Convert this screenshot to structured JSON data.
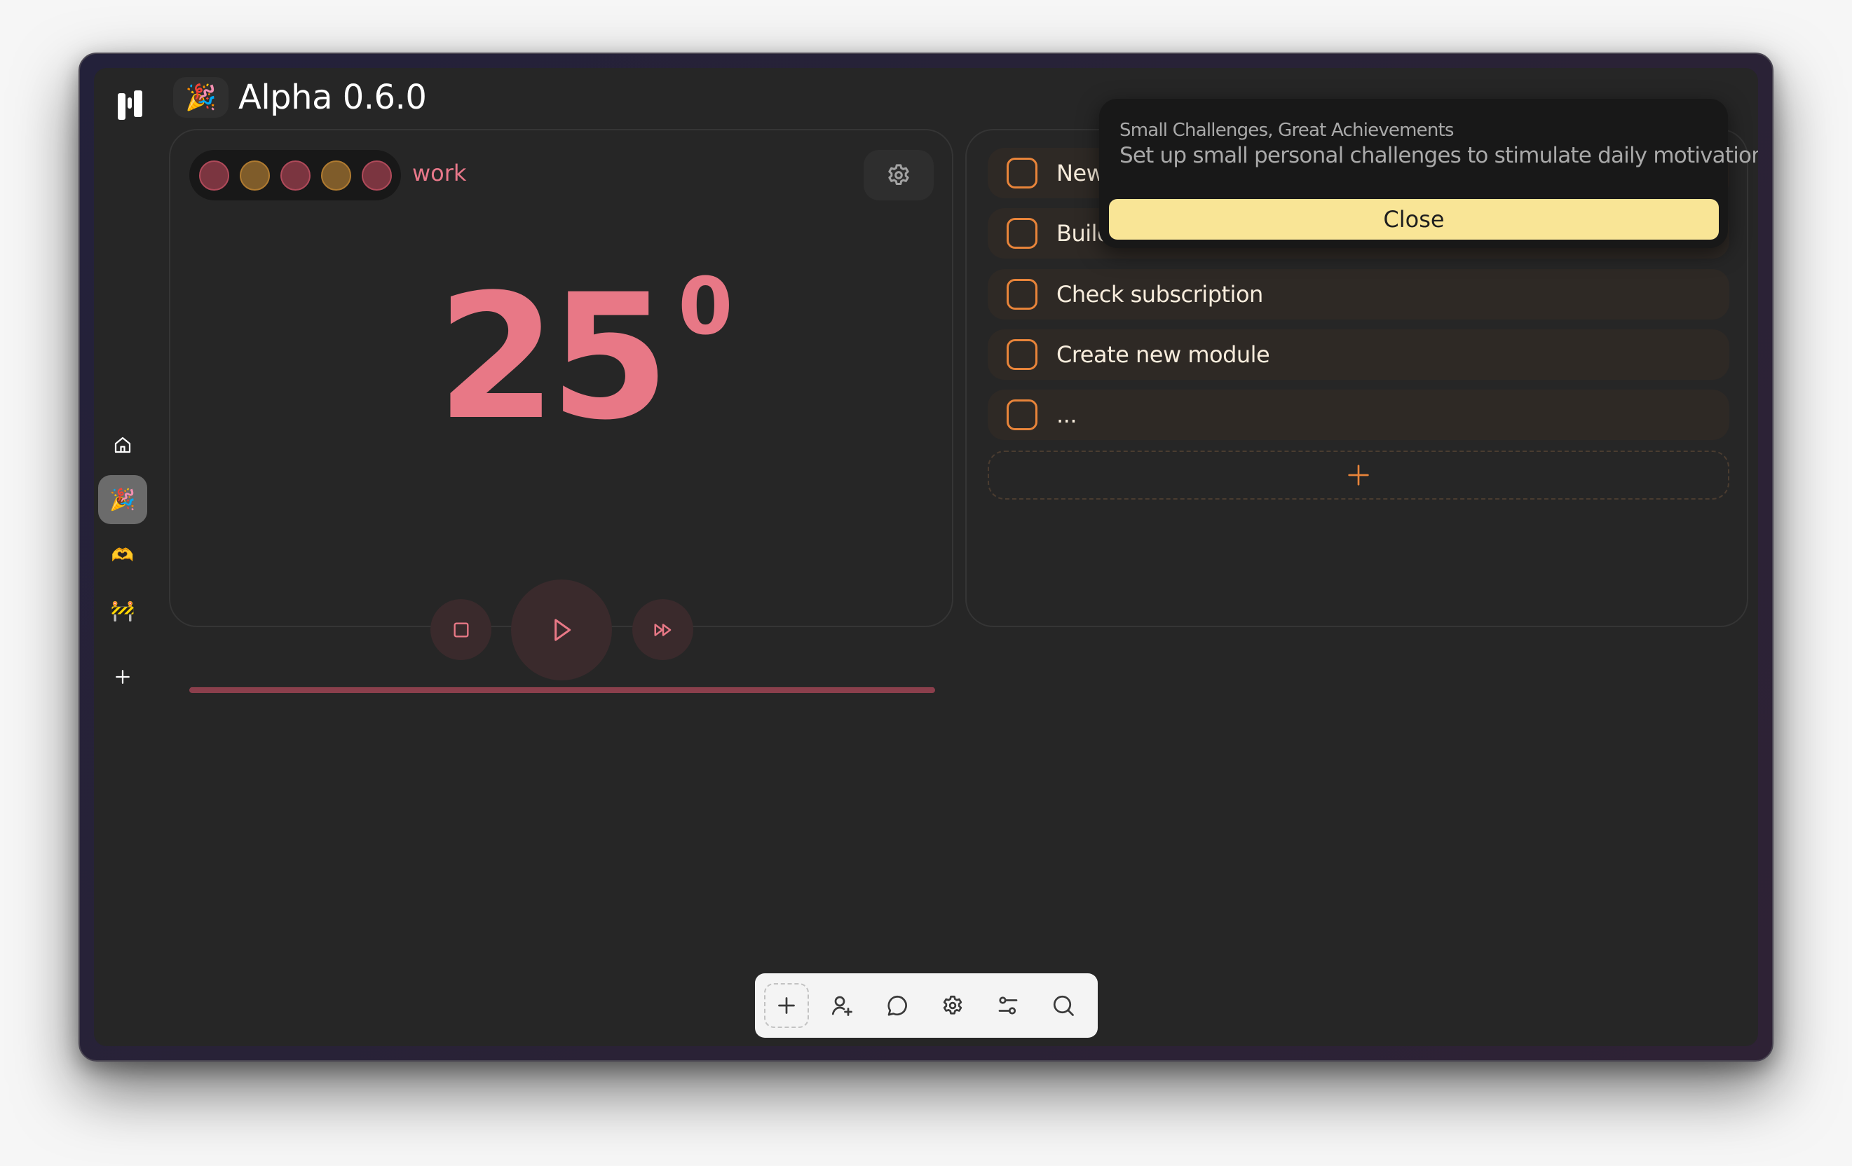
{
  "app": {
    "title": "Alpha 0.6.0",
    "title_emoji": "🎉",
    "logo_icon": "bars-logo-icon"
  },
  "sidebar": {
    "items": [
      {
        "name": "home",
        "icon": "home-icon",
        "glyph": "",
        "active": false
      },
      {
        "name": "party",
        "icon": "party-popper-icon",
        "glyph": "🎉",
        "active": true
      },
      {
        "name": "heart-hands",
        "icon": "heart-hands-icon",
        "glyph": "🫶",
        "active": false
      },
      {
        "name": "construction",
        "icon": "construction-icon",
        "glyph": "🚧",
        "active": false
      },
      {
        "name": "add",
        "icon": "plus-icon",
        "glyph": "",
        "active": false
      }
    ]
  },
  "timer": {
    "mode_label": "work",
    "sessions": [
      {
        "kind": "work",
        "color": "#7b3540"
      },
      {
        "kind": "break",
        "color": "#7f5c2a"
      },
      {
        "kind": "work",
        "color": "#7b3540"
      },
      {
        "kind": "break",
        "color": "#7f5c2a"
      },
      {
        "kind": "work",
        "color": "#7b3540"
      }
    ],
    "minutes": "25",
    "seconds_sup": "0",
    "progress": 1.0,
    "accent_color": "#e87886",
    "controls": [
      "stop",
      "play",
      "skip"
    ]
  },
  "tasks": {
    "items": [
      {
        "label": "New",
        "checked": false
      },
      {
        "label": "Build",
        "checked": false
      },
      {
        "label": "Check subscription",
        "checked": false
      },
      {
        "label": "Create new module",
        "checked": false
      },
      {
        "label": "...",
        "checked": false
      }
    ],
    "add_label": "+",
    "accent_color": "#e8843a"
  },
  "popover": {
    "title": "Small Challenges, Great Achievements",
    "body": "Set up small personal challenges to stimulate daily motivation.",
    "close_label": "Close",
    "button_color": "#f9e596"
  },
  "toolbar": {
    "buttons": [
      {
        "name": "add",
        "icon": "plus-icon"
      },
      {
        "name": "add-user",
        "icon": "user-plus-icon"
      },
      {
        "name": "chat",
        "icon": "chat-bubble-icon"
      },
      {
        "name": "settings",
        "icon": "gear-icon"
      },
      {
        "name": "filters",
        "icon": "sliders-icon"
      },
      {
        "name": "search",
        "icon": "search-icon"
      }
    ]
  }
}
